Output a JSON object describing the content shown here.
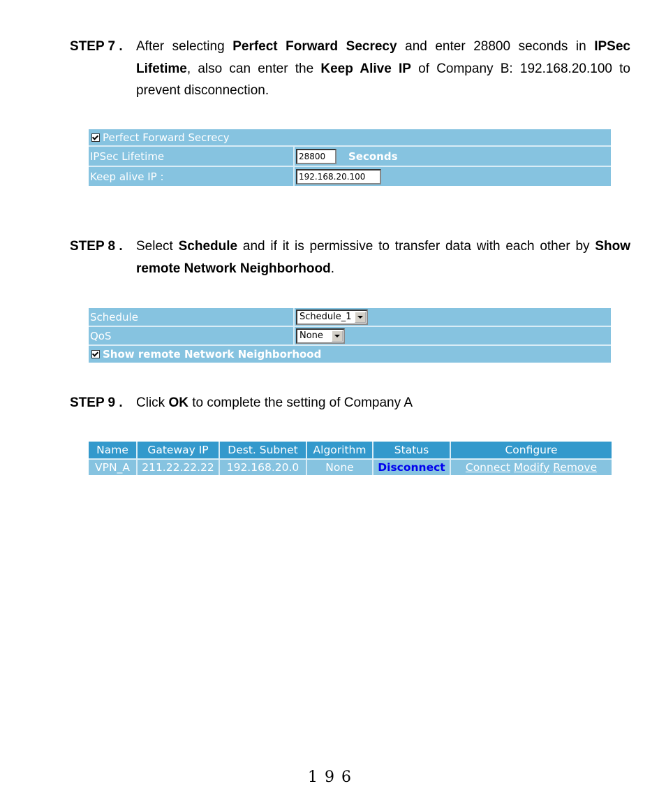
{
  "step7": {
    "label": "STEP 7 .",
    "t1": "After selecting ",
    "b1": "Perfect Forward Secrecy",
    "t2": " and enter 28800 seconds in ",
    "b2": "IPSec Lifetime",
    "t3": ", also can enter the ",
    "b3": "Keep Alive IP",
    "t4": " of Company B: 192.168.20.100 to prevent disconnection."
  },
  "panel1": {
    "pfs_label": "Perfect Forward Secrecy",
    "pfs_checked": true,
    "lifetime_label": "IPSec Lifetime",
    "lifetime_value": "28800",
    "lifetime_units": "Seconds",
    "keepalive_label": "Keep alive IP :",
    "keepalive_value": "192.168.20.100"
  },
  "step8": {
    "label": "STEP 8 .",
    "t1": "Select ",
    "b1": "Schedule",
    "t2": " and if it is permissive to transfer data with each other by ",
    "b2": "Show remote Network Neighborhood",
    "t3": "."
  },
  "panel2": {
    "schedule_label": "Schedule",
    "schedule_value": "Schedule_1",
    "qos_label": "QoS",
    "qos_value": "None",
    "neighborhood_label": "Show remote Network Neighborhood",
    "neighborhood_checked": true
  },
  "step9": {
    "label": "STEP 9 .",
    "t1": "Click ",
    "b1": "OK",
    "t2": " to complete the setting of Company A"
  },
  "vpn_table": {
    "headers": [
      "Name",
      "Gateway IP",
      "Dest. Subnet",
      "Algorithm",
      "Status",
      "Configure"
    ],
    "rows": [
      {
        "name": "VPN_A",
        "gateway_ip": "211.22.22.22",
        "dest_subnet": "192.168.20.0",
        "algorithm": "None",
        "status": "Disconnect",
        "actions": [
          "Connect",
          "Modify",
          "Remove"
        ]
      }
    ]
  },
  "colors": {
    "panel_bg": "#86C3E0",
    "header_bg": "#3399CC",
    "status_link": "#0000EE"
  },
  "page_number": "196"
}
